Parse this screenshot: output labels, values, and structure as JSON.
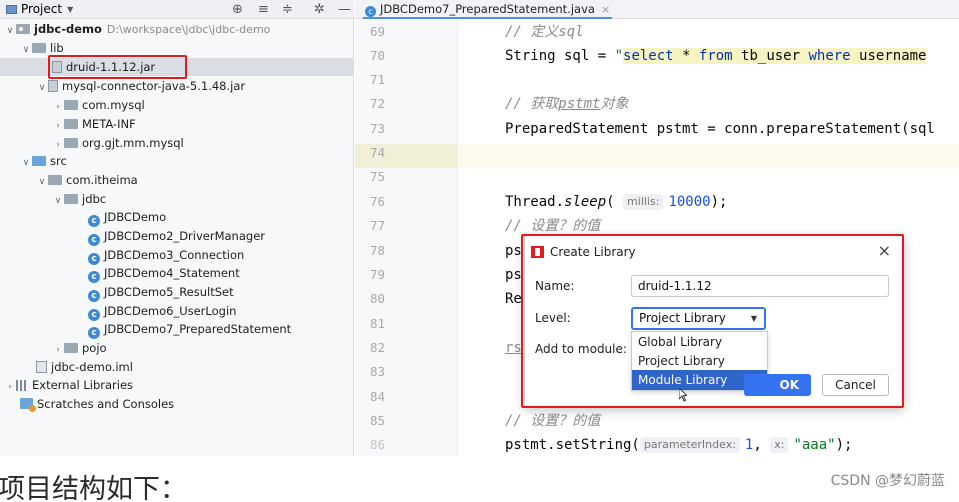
{
  "colors": {
    "highlight": "#e11a1a",
    "accent": "#3574f0",
    "selected_option": "#2f65ca",
    "current_line": "#fcfaed",
    "string": "#067d17",
    "keyword": "#0033b3",
    "number": "#1750eb",
    "comment": "#8c8c8c"
  },
  "project_panel": {
    "title": "Project",
    "tool_icons": [
      "target-icon",
      "collapse-all-icon",
      "expand-all-icon",
      "gear-icon",
      "minimize-icon"
    ],
    "tree": [
      {
        "label": "jdbc-demo",
        "extra": "D:\\workspace\\jdbc\\jdbc-demo",
        "icon": "module-folder-icon",
        "expanded": true
      },
      {
        "label": "lib",
        "icon": "folder-icon",
        "expanded": true
      },
      {
        "label": "druid-1.1.12.jar",
        "icon": "jar-icon",
        "selected": true
      },
      {
        "label": "mysql-connector-java-5.1.48.jar",
        "icon": "jar-icon",
        "expanded": true
      },
      {
        "label": "com.mysql",
        "icon": "package-icon",
        "expanded": false
      },
      {
        "label": "META-INF",
        "icon": "package-icon",
        "expanded": false
      },
      {
        "label": "org.gjt.mm.mysql",
        "icon": "package-icon",
        "expanded": false
      },
      {
        "label": "src",
        "icon": "source-folder-icon",
        "expanded": true
      },
      {
        "label": "com.itheima",
        "icon": "package-icon",
        "expanded": true
      },
      {
        "label": "jdbc",
        "icon": "package-icon",
        "expanded": true
      },
      {
        "label": "JDBCDemo",
        "icon": "class-icon"
      },
      {
        "label": "JDBCDemo2_DriverManager",
        "icon": "class-icon"
      },
      {
        "label": "JDBCDemo3_Connection",
        "icon": "class-icon"
      },
      {
        "label": "JDBCDemo4_Statement",
        "icon": "class-icon"
      },
      {
        "label": "JDBCDemo5_ResultSet",
        "icon": "class-icon"
      },
      {
        "label": "JDBCDemo6_UserLogin",
        "icon": "class-icon"
      },
      {
        "label": "JDBCDemo7_PreparedStatement",
        "icon": "class-icon"
      },
      {
        "label": "pojo",
        "icon": "package-icon",
        "expanded": false
      },
      {
        "label": "jdbc-demo.iml",
        "icon": "iml-file-icon"
      },
      {
        "label": "External Libraries",
        "icon": "libraries-icon",
        "expanded": false
      },
      {
        "label": "Scratches and Consoles",
        "icon": "scratches-icon"
      }
    ]
  },
  "editor": {
    "tab_label": "JDBCDemo7_PreparedStatement.java",
    "tab_close": "×",
    "line_numbers": [
      "69",
      "70",
      "71",
      "72",
      "73",
      "74",
      "75",
      "76",
      "77",
      "78",
      "79",
      "80",
      "81",
      "82",
      "83",
      "84",
      "85",
      "86"
    ],
    "current_line": "74",
    "code": {
      "l69": "// 定义sql",
      "l70_pre": "String sql = ",
      "l70_q": "\"",
      "l70_select": "select",
      "l70_star": " * ",
      "l70_from": "from",
      "l70_table": " tb_user ",
      "l70_where": "where",
      "l70_rest": " username",
      "l72_a": "// 获取",
      "l72_b": "pstmt",
      "l72_c": "对象",
      "l73": "PreparedStatement pstmt = conn.prepareStatement(sql",
      "l76_a": "Thread.",
      "l76_b": "sleep",
      "l76_c": "(",
      "l76_hint": "millis:",
      "l76_num": "10000",
      "l76_d": ");",
      "l77": "// 设置？的值",
      "l78": "ps",
      "l79": "ps",
      "l80": "Re",
      "l82": "rs",
      "l85": "// 设置？的值",
      "l86_a": "pstmt.setString(",
      "l86_hint1": "parameterIndex:",
      "l86_num": "1",
      "l86_b": ", ",
      "l86_hint2": "x:",
      "l86_str": "\"aaa\"",
      "l86_c": ");"
    }
  },
  "dialog": {
    "title": "Create Library",
    "close": "×",
    "name_label": "Name:",
    "name_value": "druid-1.1.12",
    "level_label": "Level:",
    "level_value": "Project Library",
    "module_label": "Add to module:",
    "options": [
      "Global Library",
      "Project Library",
      "Module Library"
    ],
    "highlighted_option": "Module Library",
    "ok_label": "OK",
    "cancel_label": "Cancel"
  },
  "caption": "项目结构如下：",
  "watermark": "CSDN @梦幻蔚蓝"
}
